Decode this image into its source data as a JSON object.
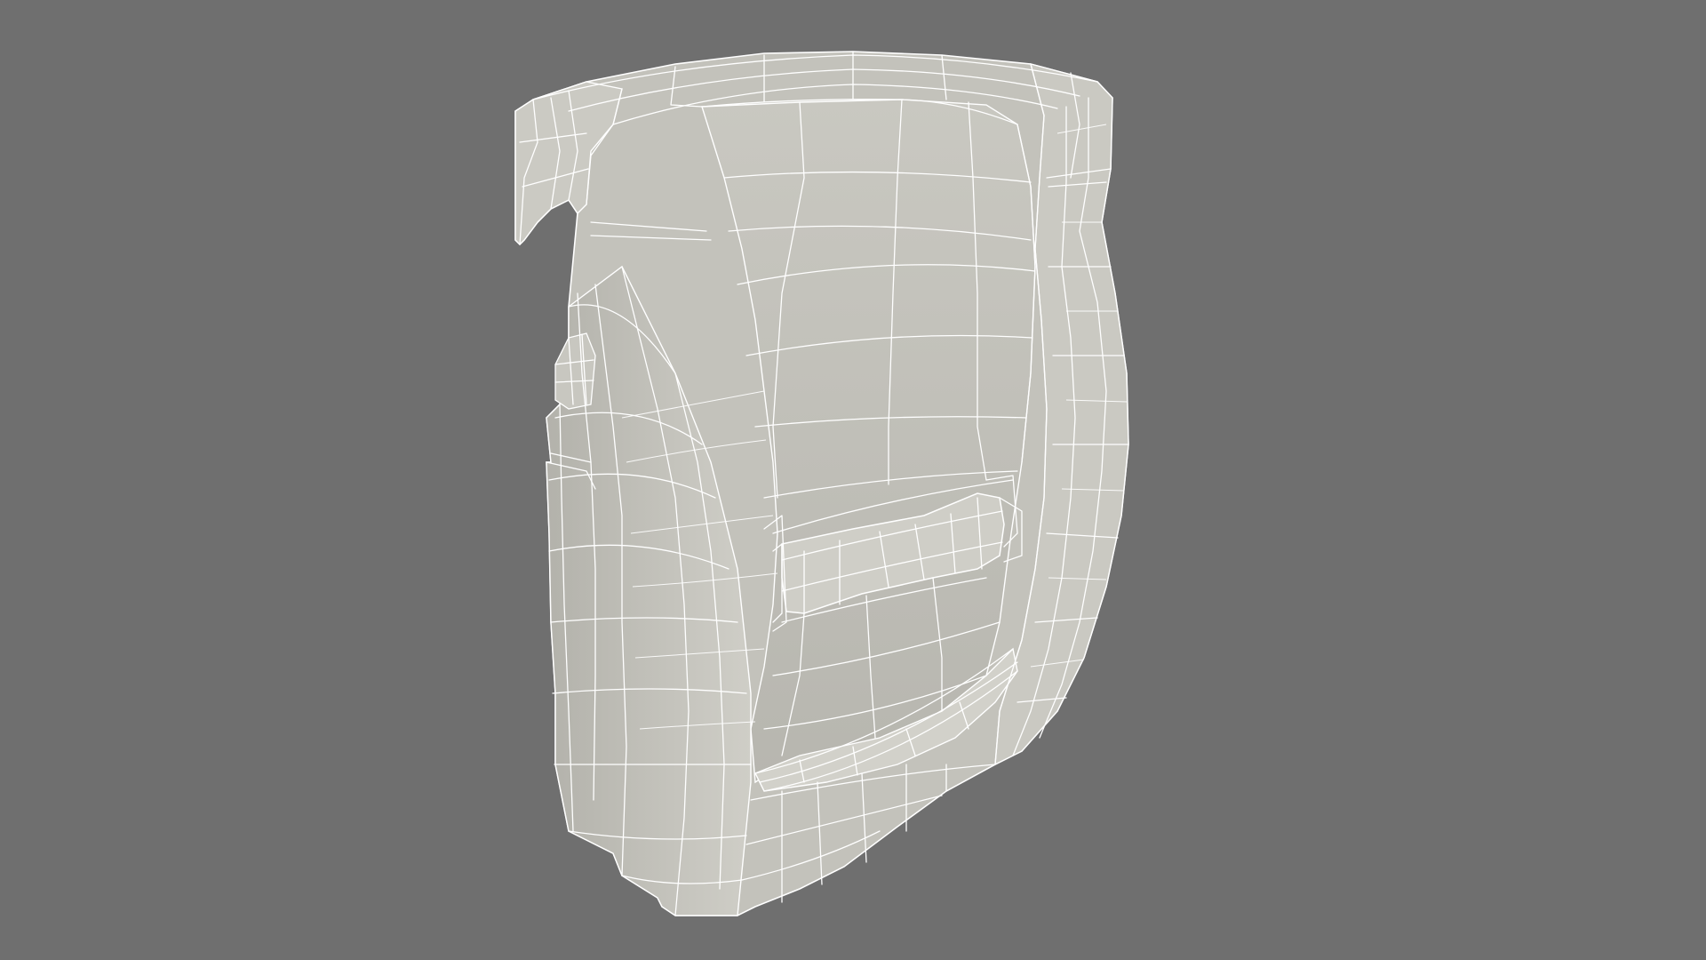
{
  "scene": {
    "background_color": "#6f6f6f",
    "object": "wireframe-3d-model",
    "object_subject": "belt-clip-holster",
    "shade_colors": {
      "main": "#c2c1ba",
      "light": "#d2d1ca",
      "inner": "#b6b5ae",
      "shadow": "#a5a49e",
      "wire": "#ffffff"
    }
  }
}
